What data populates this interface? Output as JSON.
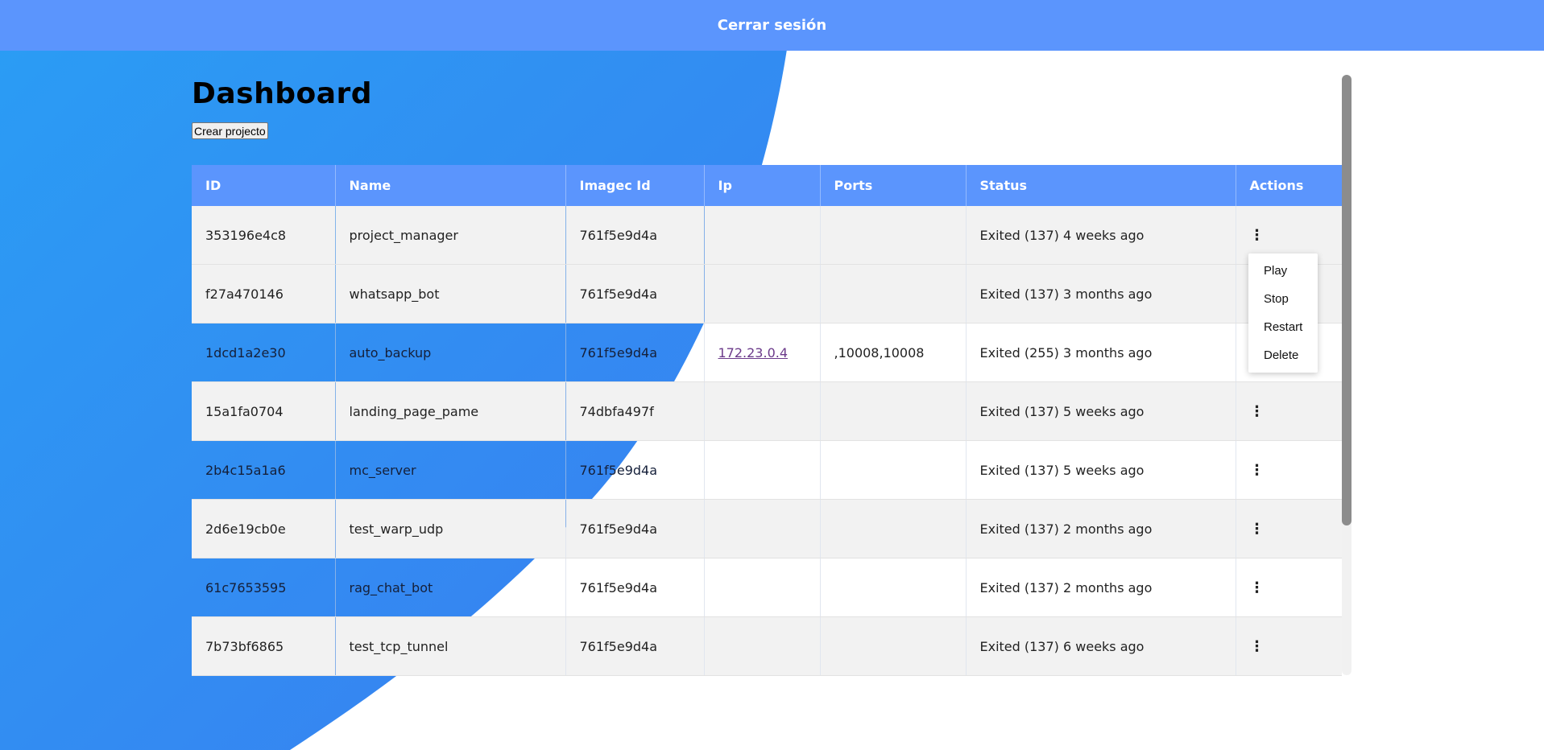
{
  "topbar": {
    "logout_label": "Cerrar sesión"
  },
  "page": {
    "title": "Dashboard",
    "create_button_label": "Crear projecto"
  },
  "colors": {
    "header_blue": "#5b95fd",
    "gradient_blue_light": "#2a9df4",
    "gradient_blue_dark": "#3a7df0",
    "link_purple": "#6b3a8a"
  },
  "table": {
    "columns": [
      "ID",
      "Name",
      "Imagec Id",
      "Ip",
      "Ports",
      "Status",
      "Actions"
    ],
    "rows": [
      {
        "id": "353196e4c8",
        "name": "project_manager",
        "image_id": "761f5e9d4a",
        "ip": "",
        "ports": "",
        "status": "Exited (137) 4 weeks ago",
        "actions_icon": "kebab-icon"
      },
      {
        "id": "f27a470146",
        "name": "whatsapp_bot",
        "image_id": "761f5e9d4a",
        "ip": "",
        "ports": "",
        "status": "Exited (137) 3 months ago",
        "actions_icon": "kebab-icon"
      },
      {
        "id": "1dcd1a2e30",
        "name": "auto_backup",
        "image_id": "761f5e9d4a",
        "ip": "172.23.0.4",
        "ports": ",10008,10008",
        "status": "Exited (255) 3 months ago",
        "actions_icon": "kebab-icon"
      },
      {
        "id": "15a1fa0704",
        "name": "landing_page_pame",
        "image_id": "74dbfa497f",
        "ip": "",
        "ports": "",
        "status": "Exited (137) 5 weeks ago",
        "actions_icon": "kebab-icon"
      },
      {
        "id": "2b4c15a1a6",
        "name": "mc_server",
        "image_id": "761f5e9d4a",
        "ip": "",
        "ports": "",
        "status": "Exited (137) 5 weeks ago",
        "actions_icon": "kebab-icon"
      },
      {
        "id": "2d6e19cb0e",
        "name": "test_warp_udp",
        "image_id": "761f5e9d4a",
        "ip": "",
        "ports": "",
        "status": "Exited (137) 2 months ago",
        "actions_icon": "kebab-icon"
      },
      {
        "id": "61c7653595",
        "name": "rag_chat_bot",
        "image_id": "761f5e9d4a",
        "ip": "",
        "ports": "",
        "status": "Exited (137) 2 months ago",
        "actions_icon": "kebab-icon"
      },
      {
        "id": "7b73bf6865",
        "name": "test_tcp_tunnel",
        "image_id": "761f5e9d4a",
        "ip": "",
        "ports": "",
        "status": "Exited (137) 6 weeks ago",
        "actions_icon": "kebab-icon"
      }
    ]
  },
  "action_menu": {
    "open_for_row": 0,
    "items": [
      "Play",
      "Stop",
      "Restart",
      "Delete"
    ]
  }
}
